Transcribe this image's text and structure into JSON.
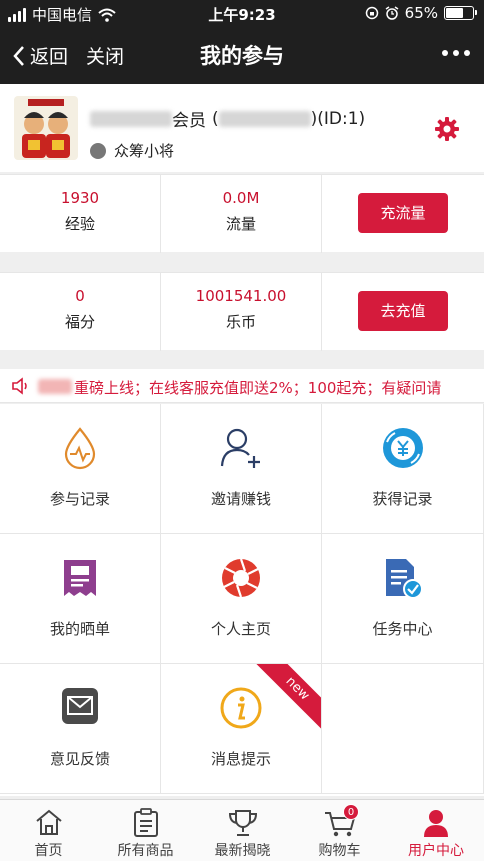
{
  "status_bar": {
    "carrier": "中国电信",
    "time": "上午9:23",
    "battery": "65%",
    "battery_level": 0.65
  },
  "nav": {
    "back_label": "返回",
    "close_label": "关闭",
    "title": "我的参与"
  },
  "profile": {
    "name_suffix": "会员",
    "id_text": ")(ID:1)",
    "id_open": "(",
    "level": "众筹小将"
  },
  "stats_row1": [
    {
      "value": "1930",
      "label": "经验"
    },
    {
      "value": "0.0M",
      "label": "流量"
    }
  ],
  "stats_row1_button": "充流量",
  "stats_row2": [
    {
      "value": "0",
      "label": "福分"
    },
    {
      "value": "1001541.00",
      "label": "乐币"
    }
  ],
  "stats_row2_button": "去充值",
  "marquee": {
    "text": "重磅上线；在线客服充值即送2%；100起充；有疑问请"
  },
  "grid": [
    {
      "label": "参与记录",
      "icon": "drop-pulse-icon"
    },
    {
      "label": "邀请赚钱",
      "icon": "add-user-icon"
    },
    {
      "label": "获得记录",
      "icon": "yuan-coin-icon"
    },
    {
      "label": "我的晒单",
      "icon": "receipt-icon"
    },
    {
      "label": "个人主页",
      "icon": "aperture-icon"
    },
    {
      "label": "任务中心",
      "icon": "task-doc-icon"
    },
    {
      "label": "意见反馈",
      "icon": "envelope-icon"
    },
    {
      "label": "消息提示",
      "icon": "info-icon",
      "ribbon": "new"
    }
  ],
  "tabs": [
    {
      "label": "首页",
      "icon": "home-icon"
    },
    {
      "label": "所有商品",
      "icon": "clipboard-icon"
    },
    {
      "label": "最新揭晓",
      "icon": "trophy-icon"
    },
    {
      "label": "购物车",
      "icon": "cart-icon",
      "badge": "0"
    },
    {
      "label": "用户中心",
      "icon": "user-icon",
      "active": true
    }
  ],
  "colors": {
    "accent": "#d51b3c",
    "bar": "#1f1f1f"
  }
}
